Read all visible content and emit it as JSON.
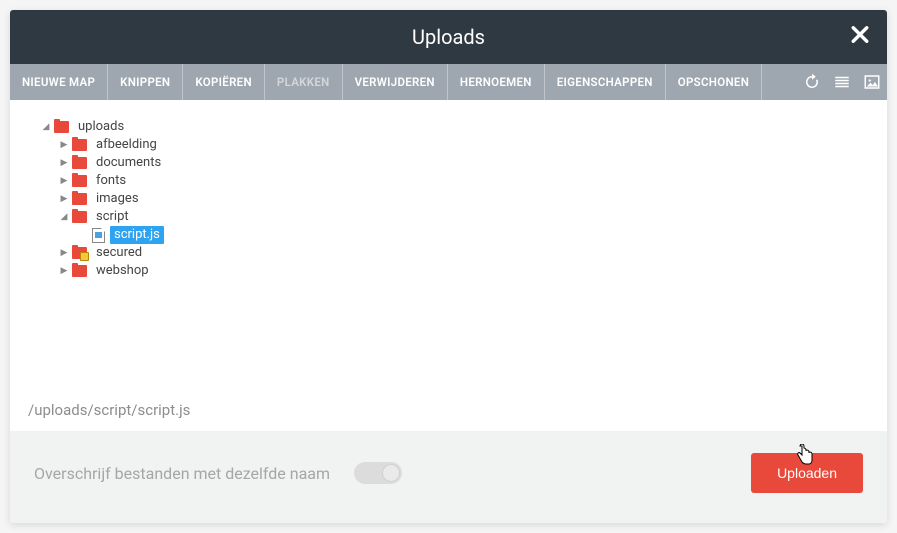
{
  "title": "Uploads",
  "toolbar": {
    "nieuwe_map": "NIEUWE MAP",
    "knippen": "KNIPPEN",
    "kopieren": "KOPIËREN",
    "plakken": "PLAKKEN",
    "verwijderen": "VERWIJDEREN",
    "hernoemen": "HERNOEMEN",
    "eigenschappen": "EIGENSCHAPPEN",
    "opschonen": "OPSCHONEN"
  },
  "tree": {
    "root": "uploads",
    "children": {
      "afbeelding": "afbeelding",
      "documents": "documents",
      "fonts": "fonts",
      "images": "images",
      "script": "script",
      "script_file": "script.js",
      "secured": "secured",
      "webshop": "webshop"
    }
  },
  "path": "/uploads/script/script.js",
  "overwrite_label": "Overschrijf bestanden met dezelfde naam",
  "upload_button": "Uploaden"
}
